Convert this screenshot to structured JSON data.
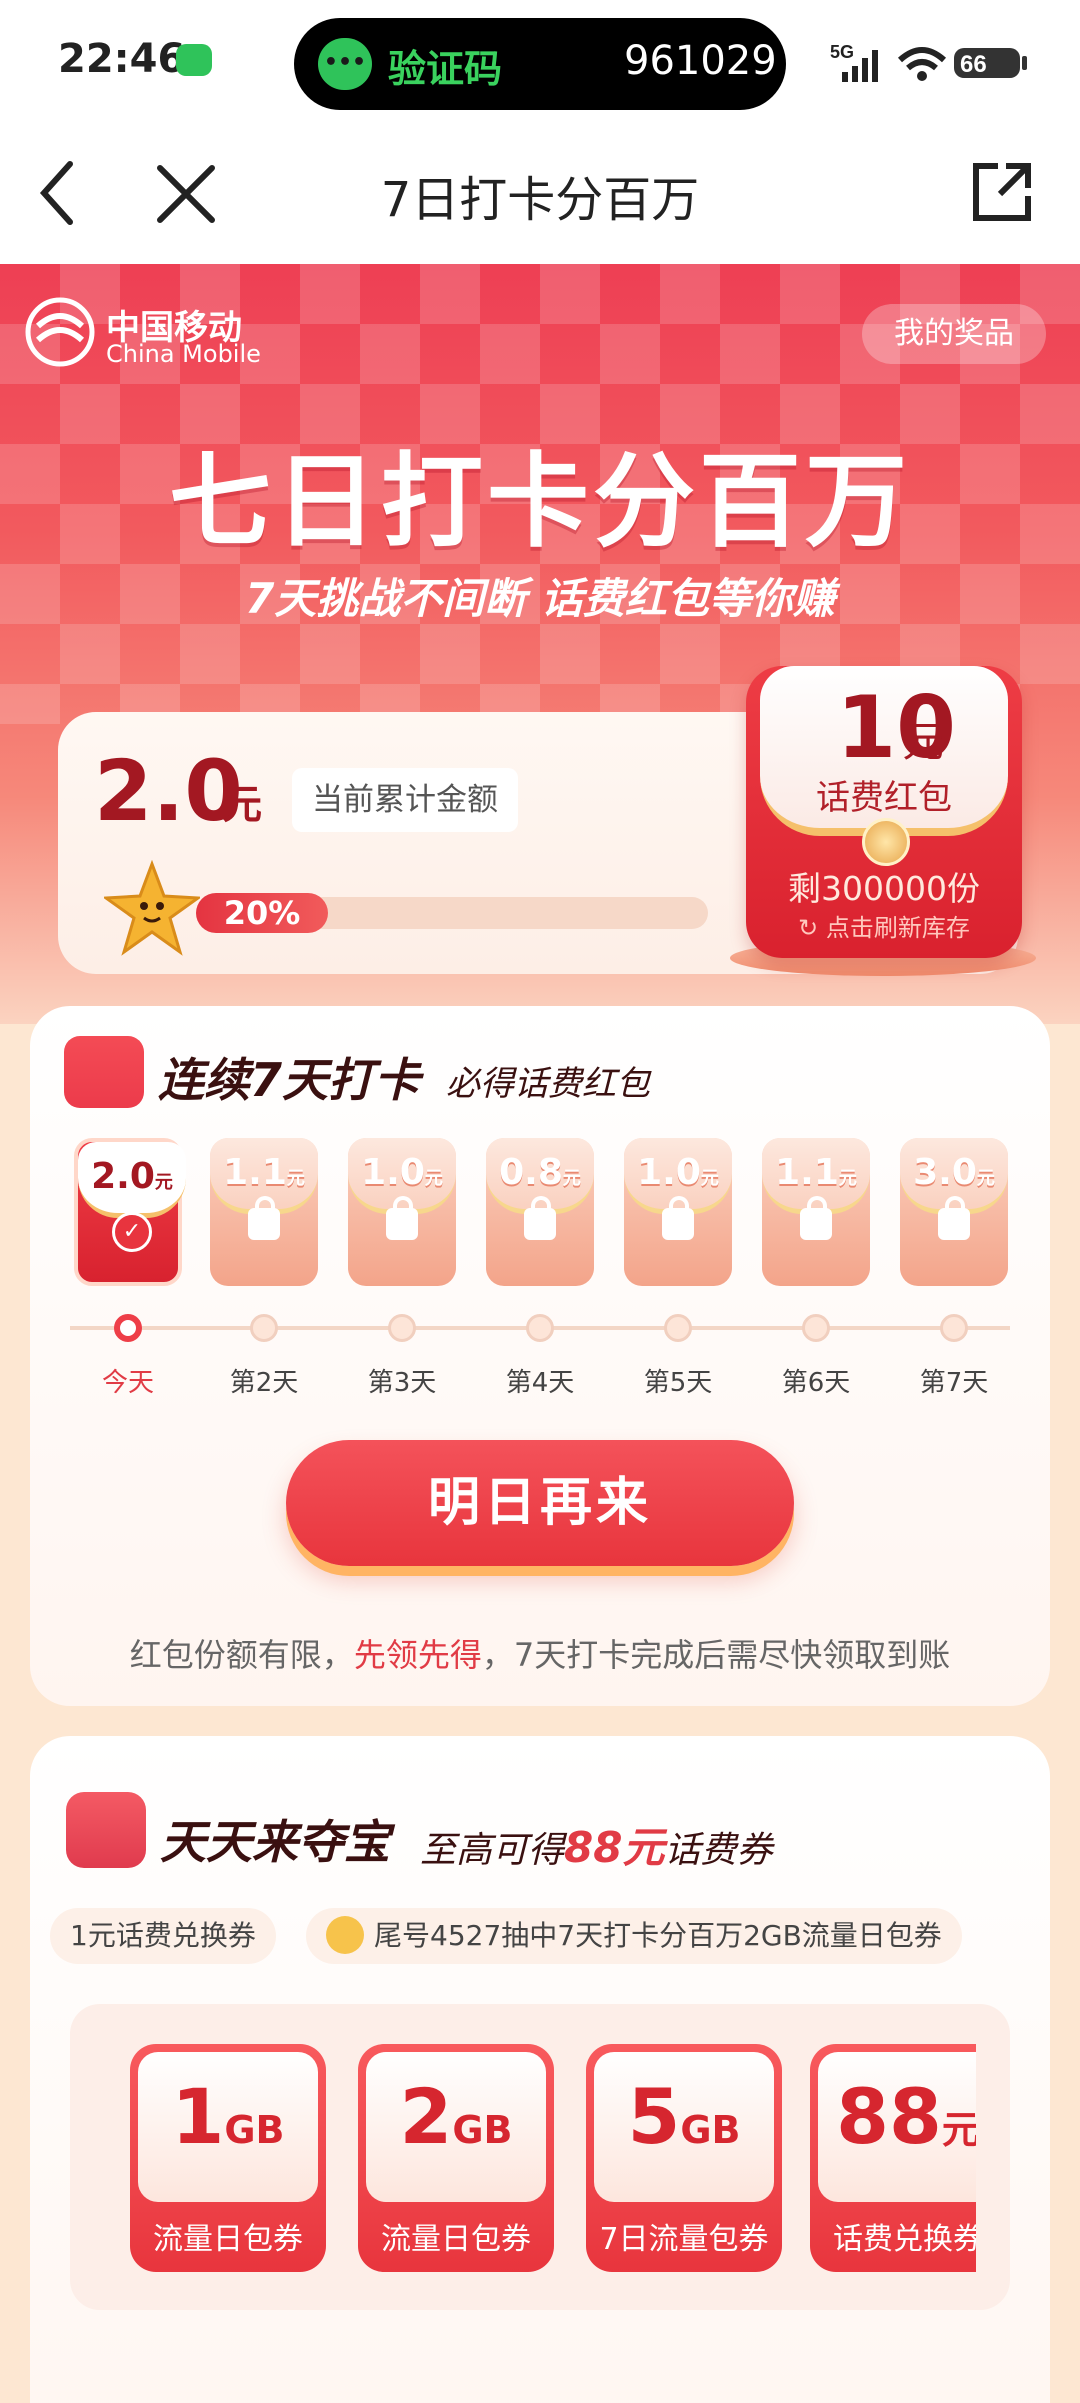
{
  "status_bar": {
    "time": "22:46",
    "notif_label": "验证码",
    "notif_code": "961029",
    "network": "5G",
    "battery": "66"
  },
  "nav": {
    "title": "7日打卡分百万"
  },
  "brand": {
    "name_cn": "中国移动",
    "name_en": "China Mobile"
  },
  "header": {
    "my_prizes": "我的奖品",
    "title": "七日打卡分百万",
    "subtitle": "7天挑战不间断 话费红包等你赚"
  },
  "summary": {
    "amount": "2.0",
    "unit": "元",
    "label": "当前累计金额",
    "progress_percent": 20,
    "progress_label": "20%"
  },
  "envelope": {
    "amount": "10",
    "unit": "元",
    "name": "话费红包",
    "remaining": "剩300000份",
    "refresh_hint": "点击刷新库存"
  },
  "checkin": {
    "title": "连续7天打卡",
    "subtitle": "必得话费红包",
    "days": [
      {
        "amount": "2.0",
        "unit": "元",
        "label": "今天",
        "state": "done"
      },
      {
        "amount": "1.1",
        "unit": "元",
        "label": "第2天",
        "state": "locked"
      },
      {
        "amount": "1.0",
        "unit": "元",
        "label": "第3天",
        "state": "locked"
      },
      {
        "amount": "0.8",
        "unit": "元",
        "label": "第4天",
        "state": "locked"
      },
      {
        "amount": "1.0",
        "unit": "元",
        "label": "第5天",
        "state": "locked"
      },
      {
        "amount": "1.1",
        "unit": "元",
        "label": "第6天",
        "state": "locked"
      },
      {
        "amount": "3.0",
        "unit": "元",
        "label": "第7天",
        "state": "locked"
      }
    ],
    "cta": "明日再来",
    "note_pre": "红包份额有限，",
    "note_hl": "先领先得",
    "note_post": "，7天打卡完成后需尽快领取到账"
  },
  "treasure": {
    "title": "天天来夺宝",
    "subtitle_pre": "至高可得",
    "subtitle_hl": "88元",
    "subtitle_post": "话费券",
    "ticker": [
      "1元话费兑换券",
      "尾号4527抽中7天打卡分百万2GB流量日包券"
    ],
    "vouchers": [
      {
        "big": "1",
        "unit": "GB",
        "name": "流量日包券"
      },
      {
        "big": "2",
        "unit": "GB",
        "name": "流量日包券"
      },
      {
        "big": "5",
        "unit": "GB",
        "name": "7日流量包券"
      },
      {
        "big": "88",
        "unit": "元",
        "name": "话费兑换券"
      }
    ]
  },
  "colors": {
    "accent": "#e8353d",
    "dark_red": "#a31822",
    "gold": "#f5c06b"
  }
}
